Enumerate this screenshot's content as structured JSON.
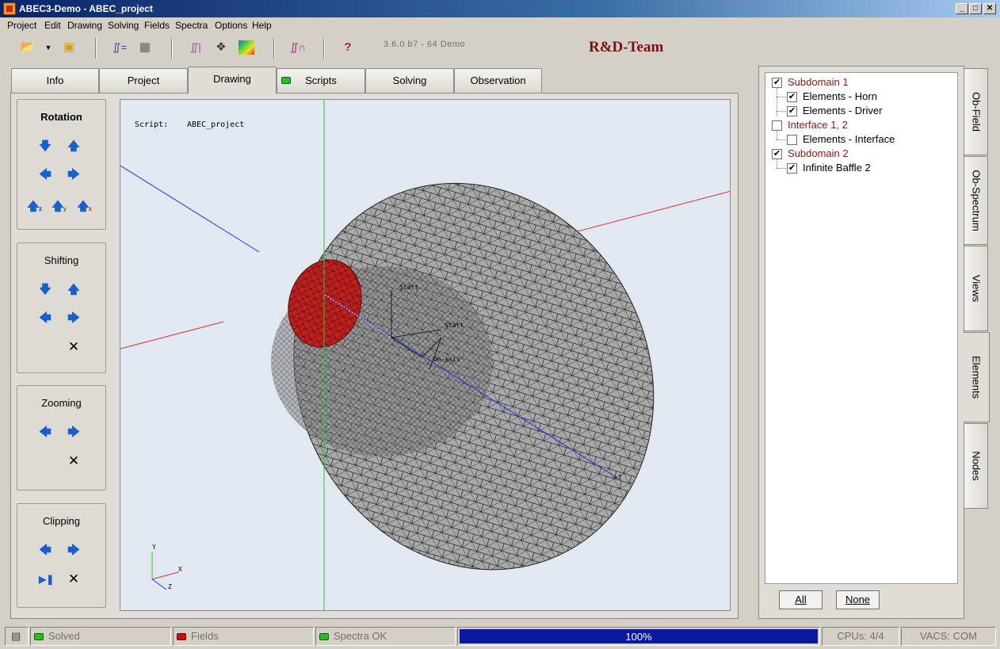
{
  "window": {
    "title": "ABEC3-Demo - ABEC_project",
    "buttons": [
      "_",
      "□",
      "✕"
    ]
  },
  "menu": [
    "Project",
    "Edit",
    "Drawing",
    "Solving",
    "Fields",
    "Spectra",
    "Options",
    "Help"
  ],
  "toolbar": {
    "version": "3.6.0 b7 - 64 Demo",
    "brand": "R&D-Team"
  },
  "tabs": [
    "Info",
    "Project",
    "Drawing",
    "Scripts",
    "Solving",
    "Observation"
  ],
  "active_tab": "Drawing",
  "controls": {
    "rotation": "Rotation",
    "shifting": "Shifting",
    "zooming": "Zooming",
    "clipping": "Clipping",
    "axis_labels": [
      "z",
      "y",
      "x"
    ]
  },
  "viewport": {
    "script_label": "Script:",
    "script_name": "ABEC_project",
    "labels": {
      "start1": "Start",
      "start2": "Start",
      "dn_axis": "Dn-axis",
      "plus_z": "+Z"
    },
    "axes": {
      "y": "Y",
      "x": "X",
      "z": "Z"
    },
    "colors": {
      "background": "#e1e8f1",
      "mesh_fill": "#a8a8a8",
      "driver_fill": "#c02020",
      "x_axis": "#e03030",
      "y_axis": "#20d020",
      "z_axis": "#2030e0"
    }
  },
  "elements_tree": [
    {
      "label": "Subdomain 1",
      "checked": true,
      "level": 0,
      "red": true
    },
    {
      "label": "Elements - Horn",
      "checked": true,
      "level": 1,
      "red": false
    },
    {
      "label": "Elements - Driver",
      "checked": true,
      "level": 1,
      "red": false
    },
    {
      "label": "Interface 1, 2",
      "checked": false,
      "level": 0,
      "red": true
    },
    {
      "label": "Elements - Interface",
      "checked": false,
      "level": 1,
      "red": false
    },
    {
      "label": "Subdomain 2",
      "checked": true,
      "level": 0,
      "red": true
    },
    {
      "label": "Infinite Baffle 2",
      "checked": true,
      "level": 1,
      "red": false
    }
  ],
  "tree_buttons": {
    "all": "All",
    "none": "None"
  },
  "side_tabs": [
    "Ob-Field",
    "Ob-Spectrum",
    "Views",
    "Elements",
    "Nodes"
  ],
  "active_side_tab": "Elements",
  "status": {
    "solved": "Solved",
    "fields": "Fields",
    "spectra": "Spectra OK",
    "progress_text": "100%",
    "progress": 1.0,
    "cpus": "CPUs: 4/4",
    "vacs": "VACS: COM"
  }
}
